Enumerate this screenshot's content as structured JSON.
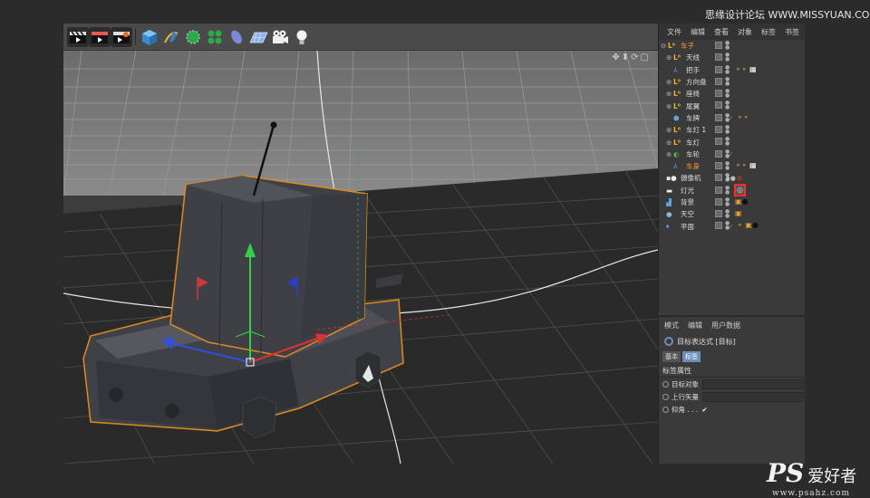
{
  "watermarks": {
    "top": "思缘设计论坛 WWW.MISSYUAN.COM",
    "bottom_logo": "PS",
    "bottom_cn": "爱好者",
    "bottom_url": "www.psahz.com"
  },
  "object_manager": {
    "menu": [
      "文件",
      "编辑",
      "查看",
      "对象",
      "标签",
      "书签"
    ],
    "objects": [
      {
        "name": "车子",
        "color": "#ff9933",
        "icon_color": "#d88a2a"
      },
      {
        "name": "天线",
        "color": "#dddddd",
        "icon_color": "#9fa8b8"
      },
      {
        "name": "把手",
        "color": "#dddddd",
        "icon_color": "#5da4e0"
      },
      {
        "name": "方向盘",
        "color": "#dddddd",
        "icon_color": "#9fa8b8"
      },
      {
        "name": "座椅",
        "color": "#dddddd",
        "icon_color": "#9fa8b8"
      },
      {
        "name": "尾翼",
        "color": "#dddddd",
        "icon_color": "#9fa8b8"
      },
      {
        "name": "车牌",
        "color": "#dddddd",
        "icon_color": "#5da4e0"
      },
      {
        "name": "车灯 1",
        "color": "#dddddd",
        "icon_color": "#9fa8b8"
      },
      {
        "name": "车灯",
        "color": "#dddddd",
        "icon_color": "#9fa8b8"
      },
      {
        "name": "车轮",
        "color": "#dddddd",
        "icon_color": "#4cbb4c"
      },
      {
        "name": "车身",
        "color": "#ff9933",
        "icon_color": "#5da4e0"
      },
      {
        "name": "摄像机",
        "color": "#dddddd",
        "icon_color": "#222222"
      },
      {
        "name": "灯光",
        "color": "#dddddd",
        "icon_color": "#eeeeee"
      },
      {
        "name": "背景",
        "color": "#dddddd",
        "icon_color": "#5da4e0"
      },
      {
        "name": "天空",
        "color": "#dddddd",
        "icon_color": "#8fb4e0"
      },
      {
        "name": "平面",
        "color": "#dddddd",
        "icon_color": "#5da4e0"
      }
    ]
  },
  "attribute_manager": {
    "menu": [
      "模式",
      "编辑",
      "用户数据"
    ],
    "title": "目标表达式 [目标]",
    "tabs": [
      "基本",
      "标签"
    ],
    "section": "标签属性",
    "fields": [
      {
        "label": "目标对象",
        "value": ""
      },
      {
        "label": "上行矢量",
        "value": ""
      },
      {
        "label": "仰角 . . .",
        "value": "✔"
      }
    ]
  },
  "colors": {
    "accent": "#6c8fb8",
    "selection_outline": "#e08a1e",
    "highlight_box": "#ff2a2a"
  },
  "icons": {
    "toolbar": [
      "render-view-icon",
      "render-picture-icon",
      "render-settings-icon",
      "cube-icon",
      "pen-spline-icon",
      "subdivision-icon",
      "array-icon",
      "deformer-icon",
      "floor-plane-icon",
      "camera-icon",
      "light-icon"
    ]
  }
}
